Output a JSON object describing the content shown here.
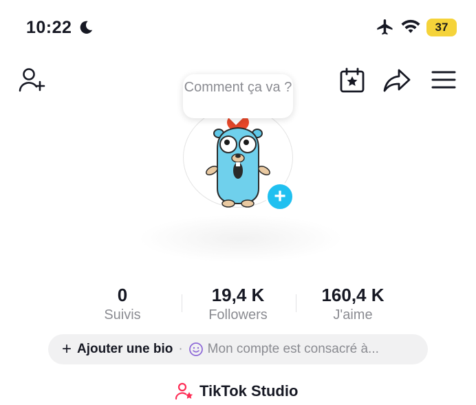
{
  "status_bar": {
    "time": "10:22",
    "battery": "37",
    "icons": [
      "moon-icon",
      "airplane-icon",
      "wifi-icon",
      "battery-icon"
    ],
    "battery_color": "#f5d33a"
  },
  "top_nav": {
    "icons": [
      "add-friend-icon",
      "calendar-star-icon",
      "share-icon",
      "menu-icon"
    ]
  },
  "profile": {
    "bubble_text": "Comment ça va ?",
    "add_avatar_icon": "plus",
    "accent_color": "#20c0f0"
  },
  "stats": [
    {
      "value": "0",
      "label": "Suivis"
    },
    {
      "value": "19,4 K",
      "label": "Followers"
    },
    {
      "value": "160,4 K",
      "label": "J'aime"
    }
  ],
  "bio": {
    "add_label": "Ajouter une bio",
    "separator": "·",
    "text": "Mon compte est consacré à..."
  },
  "studio": {
    "label": "TikTok Studio",
    "icon_color": "#fe2c55"
  }
}
